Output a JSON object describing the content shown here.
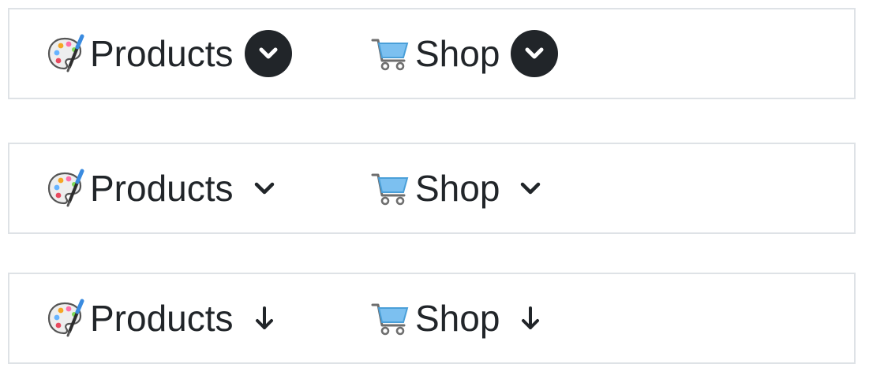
{
  "icons": {
    "products": "palette-icon",
    "shop": "shopping-cart-icon"
  },
  "colors": {
    "text": "#212529",
    "border": "#dee2e6",
    "caret_circle": "#212529",
    "cart": "#5aa9e6"
  },
  "navbars": [
    {
      "caret_style": "circle-chevron-down",
      "items": [
        {
          "label": "Products",
          "caret_icon": "circle-chevron-down-icon"
        },
        {
          "label": "Shop",
          "caret_icon": "circle-chevron-down-icon"
        }
      ]
    },
    {
      "caret_style": "chevron-down",
      "items": [
        {
          "label": "Products",
          "caret_icon": "chevron-down-icon"
        },
        {
          "label": "Shop",
          "caret_icon": "chevron-down-icon"
        }
      ]
    },
    {
      "caret_style": "arrow-down",
      "items": [
        {
          "label": "Products",
          "caret_icon": "arrow-down-icon"
        },
        {
          "label": "Shop",
          "caret_icon": "arrow-down-icon"
        }
      ]
    }
  ]
}
